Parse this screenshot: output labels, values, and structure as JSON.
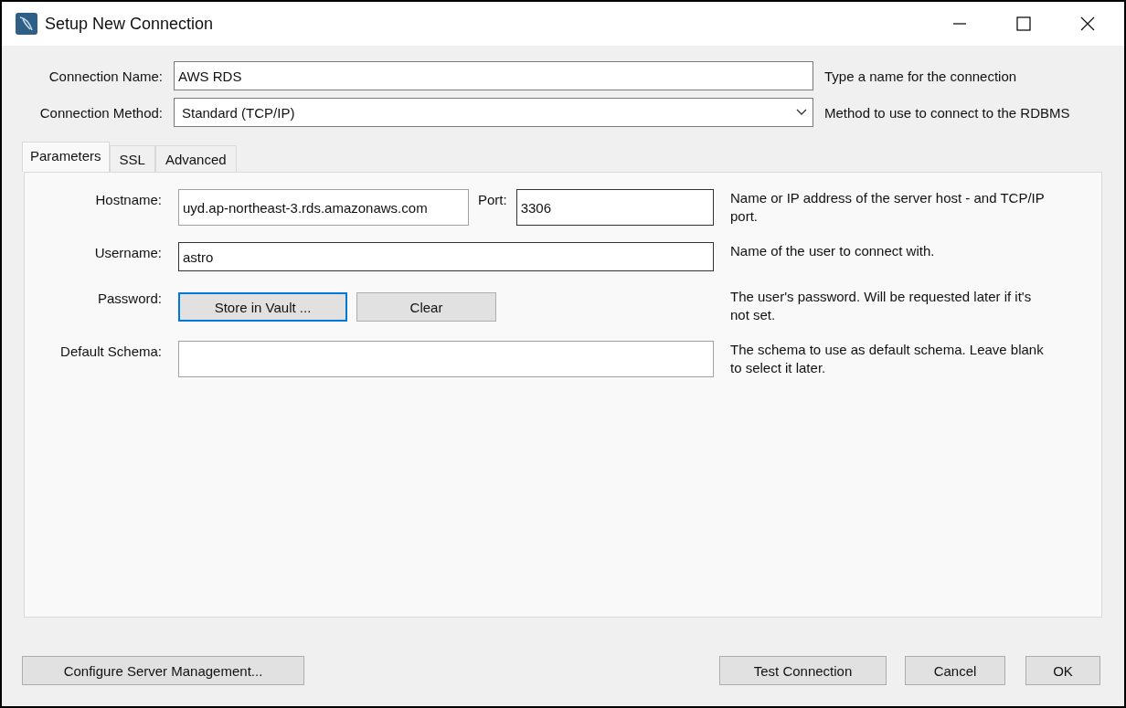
{
  "window": {
    "title": "Setup New Connection"
  },
  "connection_name": {
    "label": "Connection Name:",
    "value": "AWS RDS",
    "hint": "Type a name for the connection"
  },
  "connection_method": {
    "label": "Connection Method:",
    "value": "Standard (TCP/IP)",
    "hint": "Method to use to connect to the RDBMS"
  },
  "tabs": [
    {
      "label": "Parameters",
      "selected": true
    },
    {
      "label": "SSL",
      "selected": false
    },
    {
      "label": "Advanced",
      "selected": false
    }
  ],
  "parameters": [
    {
      "kind": "host_port",
      "label": "Hostname:",
      "value": "uyd.ap-northeast-3.rds.amazonaws.com",
      "port_label": "Port:",
      "port_value": "3306",
      "hint": "Name or IP address of the server host - and TCP/IP port."
    },
    {
      "kind": "text",
      "label": "Username:",
      "value": "astro",
      "hint": "Name of the user to connect with."
    },
    {
      "kind": "buttons",
      "label": "Password:",
      "buttons": [
        {
          "label": "Store in Vault ...",
          "focused": true
        },
        {
          "label": "Clear",
          "focused": false
        }
      ],
      "hint": "The user's password. Will be requested later if it's not set."
    },
    {
      "kind": "text",
      "label": "Default Schema:",
      "hint": "The schema to use as default schema. Leave blank to select it later."
    }
  ],
  "footer_buttons": [
    {
      "label": "Configure Server Management...",
      "focused": false
    },
    {
      "label": "Test Connection",
      "focused": false
    },
    {
      "label": "Cancel",
      "focused": false
    },
    {
      "label": "OK",
      "focused": false
    }
  ]
}
